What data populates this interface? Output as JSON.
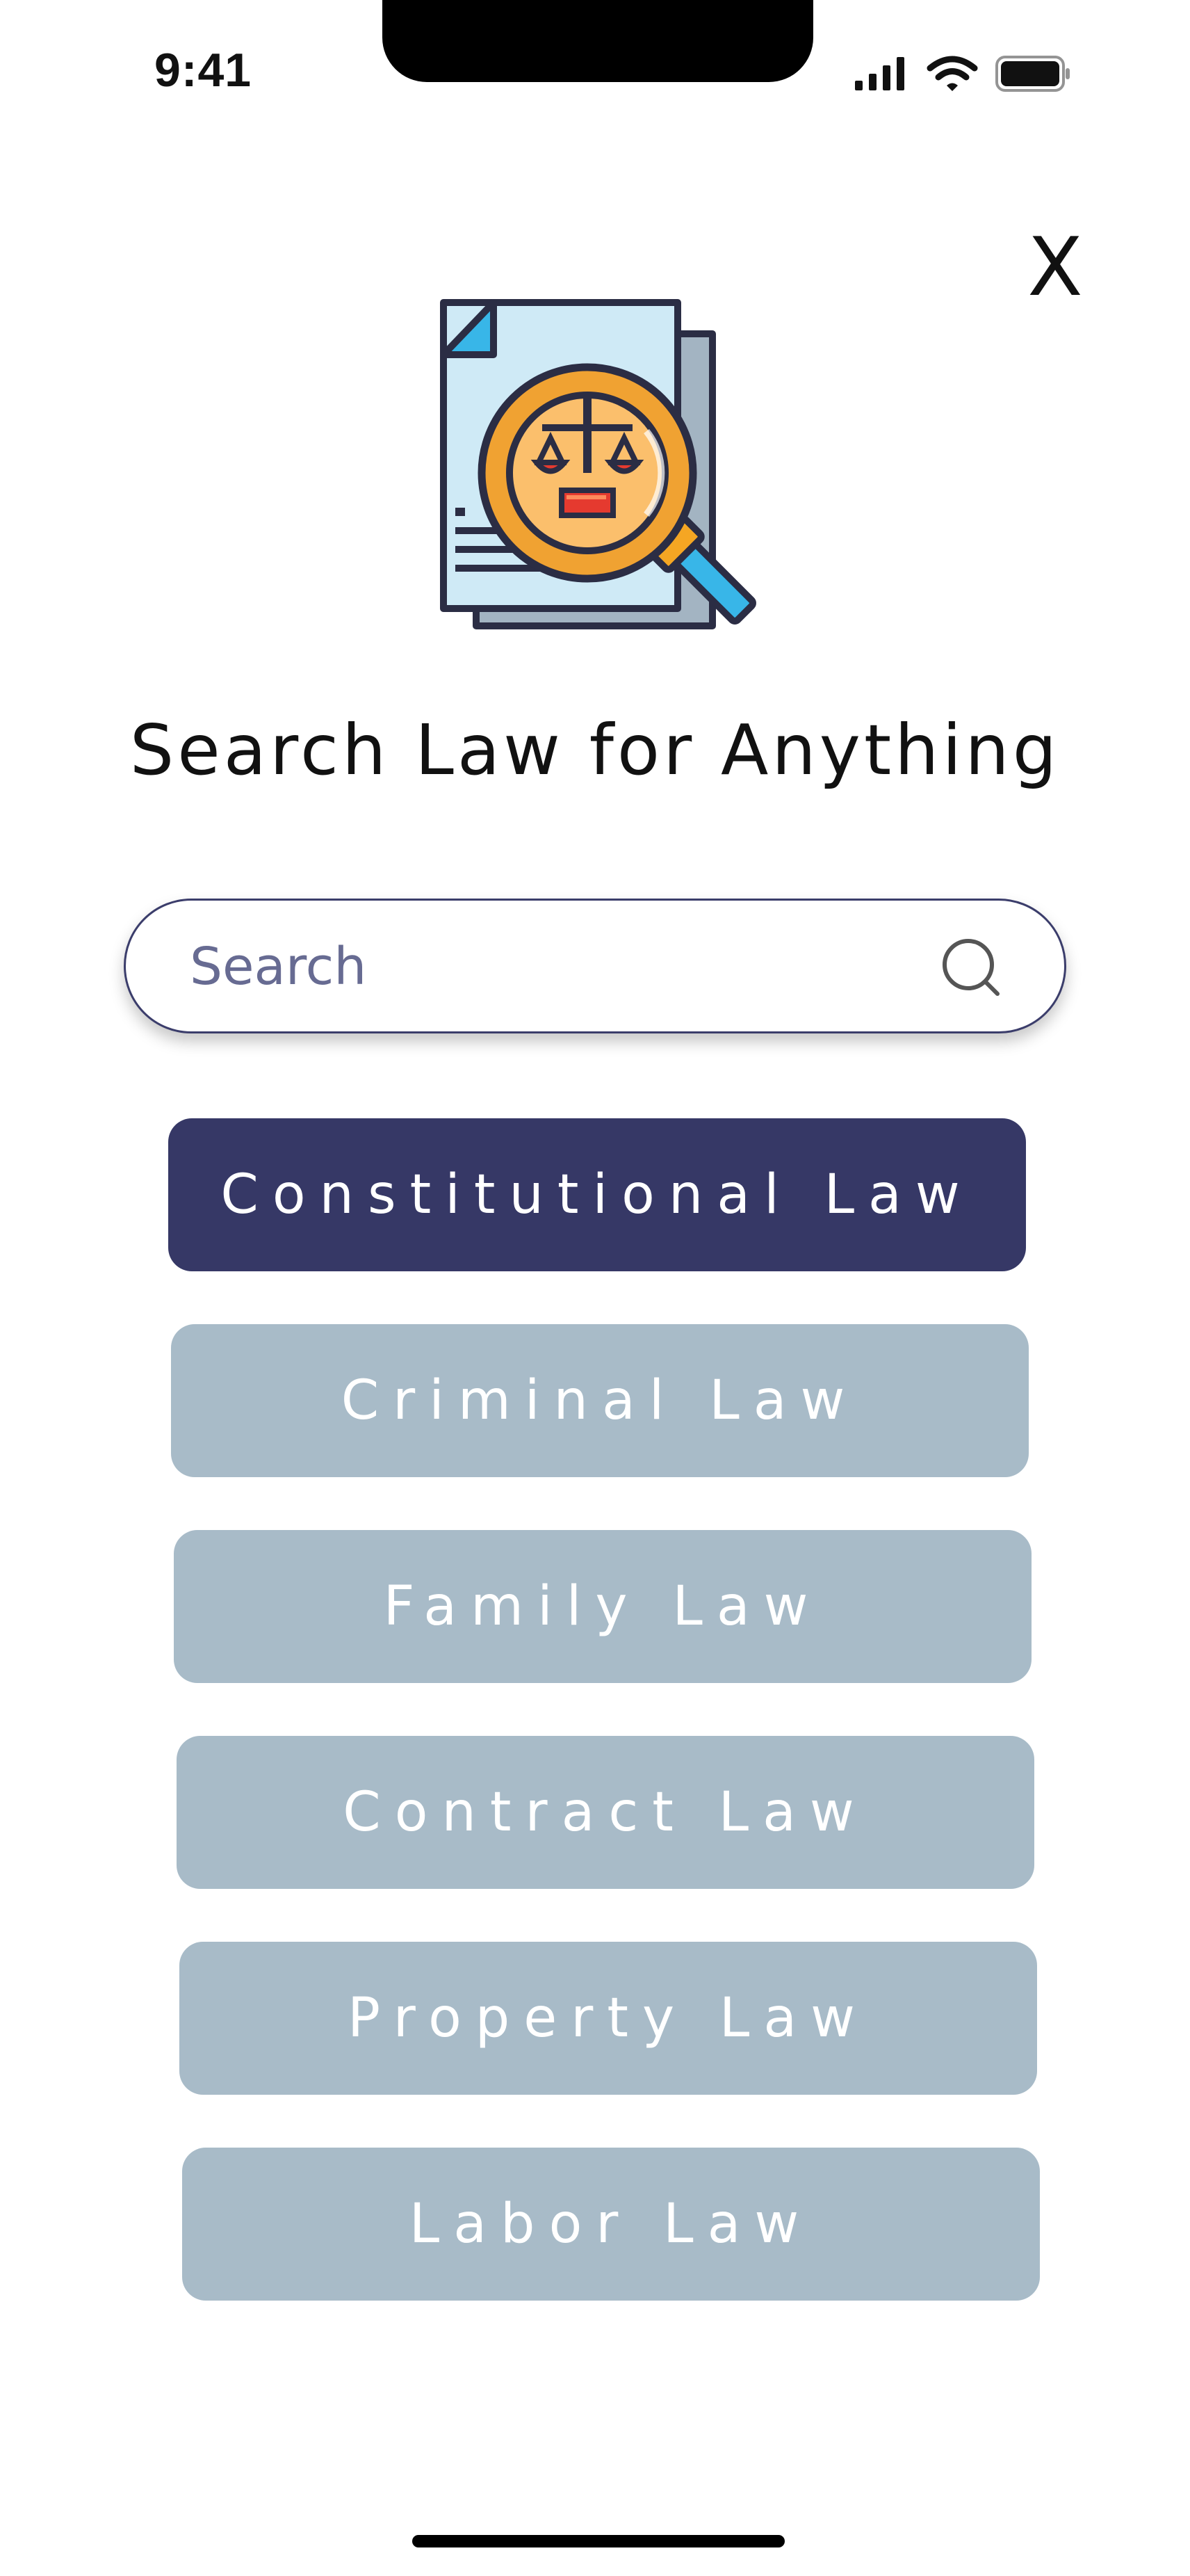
{
  "status_bar": {
    "time": "9:41"
  },
  "close": {
    "label": "X"
  },
  "header": {
    "title": "Search Law for Anything"
  },
  "search": {
    "placeholder": "Search",
    "value": ""
  },
  "categories": [
    {
      "label": "Constitutional Law",
      "active": true
    },
    {
      "label": "Criminal Law",
      "active": false
    },
    {
      "label": "Family Law",
      "active": false
    },
    {
      "label": "Contract Law",
      "active": false
    },
    {
      "label": "Property Law",
      "active": false
    },
    {
      "label": "Labor Law",
      "active": false
    }
  ],
  "colors": {
    "active_button": "#363866",
    "inactive_button": "#a8bbc8",
    "search_border": "#3b3d6b",
    "placeholder": "#676b92"
  },
  "icons": {
    "hero": "law-document-magnifier-icon",
    "search": "search-icon",
    "signal": "signal-icon",
    "wifi": "wifi-icon",
    "battery": "battery-icon"
  }
}
